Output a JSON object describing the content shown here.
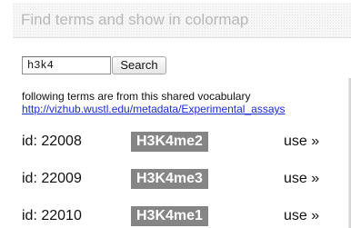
{
  "header": {
    "title": "Find terms and show in colormap"
  },
  "search": {
    "value": "h3k4",
    "button_label": "Search"
  },
  "vocabulary": {
    "note": "following terms are from this shared vocabulary",
    "link_text": "http://vizhub.wustl.edu/metadata/Experimental_assays"
  },
  "terms": [
    {
      "id_label": "id: 22008",
      "name": "H3K4me2",
      "action_label": "use »"
    },
    {
      "id_label": "id: 22009",
      "name": "H3K4me3",
      "action_label": "use »"
    },
    {
      "id_label": "id: 22010",
      "name": "H3K4me1",
      "action_label": "use »"
    }
  ],
  "colors": {
    "badge_bg": "#858585",
    "link": "#1a2bd6",
    "header_text": "#b8b8b8"
  }
}
